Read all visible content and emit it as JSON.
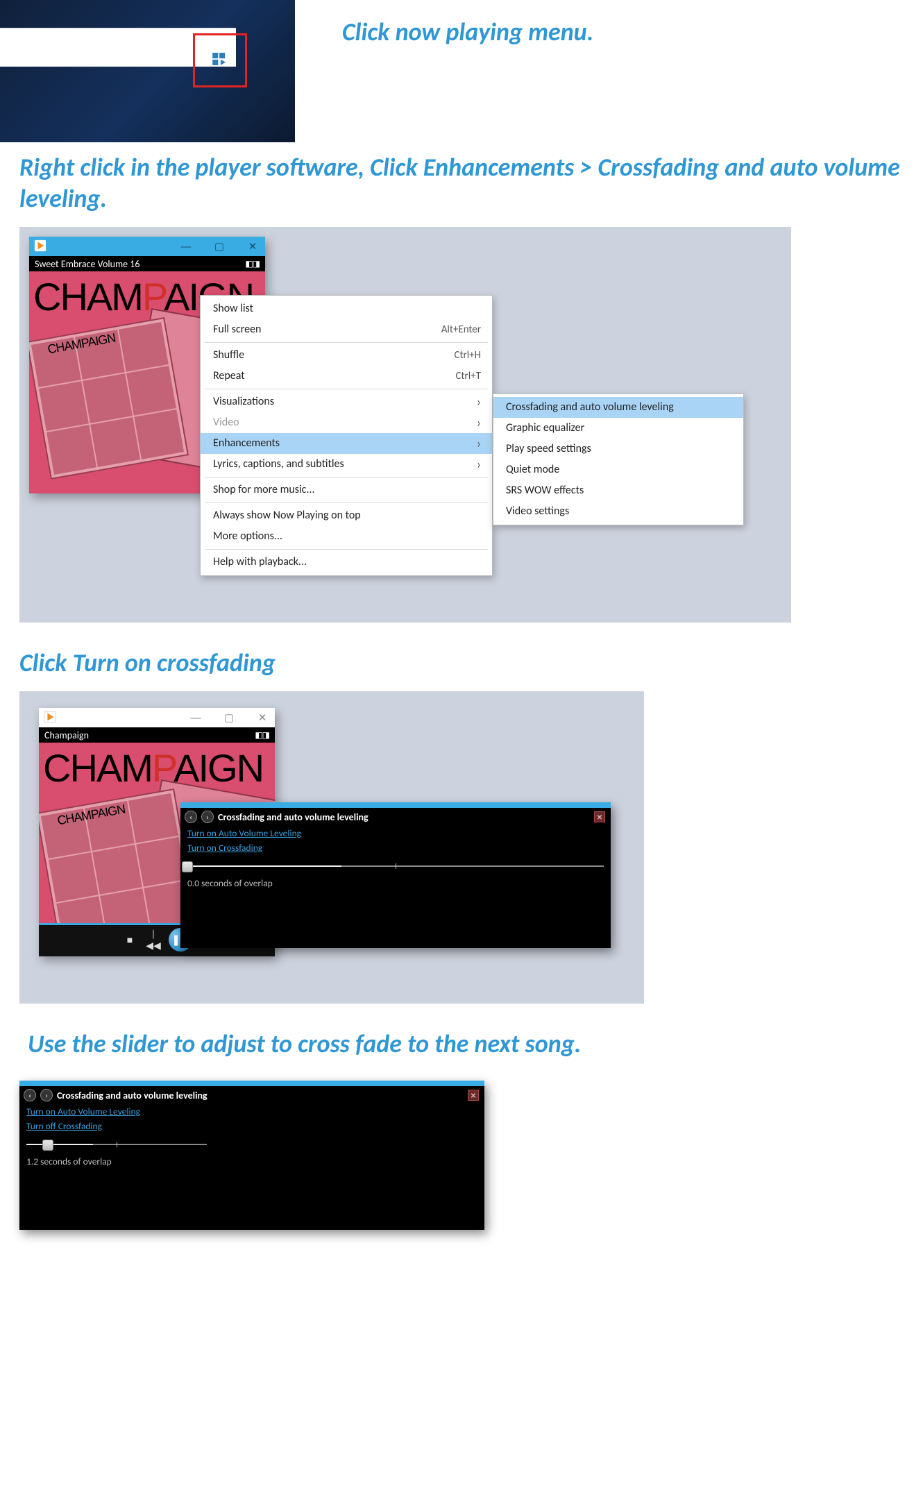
{
  "step1": {
    "instruction": "Click now playing menu."
  },
  "step2": {
    "instruction": "Right click in the player software, Click Enhancements > Crossfading and auto volume leveling.",
    "player": {
      "now_playing_title": "Sweet Embrace Volume 16",
      "album_art_text_pre": "CHAM",
      "album_art_text_mid": "P",
      "album_art_text_post": "AIGN",
      "mini_title": "CHAMPAIGN"
    },
    "context_menu": {
      "rows": [
        {
          "label": "Show list",
          "shortcut": "",
          "sub": false,
          "disabled": false
        },
        {
          "label": "Full screen",
          "shortcut": "Alt+Enter",
          "sub": false,
          "disabled": false
        },
        {
          "label": "Shuffle",
          "shortcut": "Ctrl+H",
          "sub": false,
          "disabled": false
        },
        {
          "label": "Repeat",
          "shortcut": "Ctrl+T",
          "sub": false,
          "disabled": false
        },
        {
          "label": "Visualizations",
          "shortcut": "",
          "sub": true,
          "disabled": false
        },
        {
          "label": "Video",
          "shortcut": "",
          "sub": true,
          "disabled": true
        },
        {
          "label": "Enhancements",
          "shortcut": "",
          "sub": true,
          "disabled": false,
          "hl": true
        },
        {
          "label": "Lyrics, captions, and subtitles",
          "shortcut": "",
          "sub": true,
          "disabled": false
        },
        {
          "label": "Shop for more music...",
          "shortcut": "",
          "sub": false,
          "disabled": false
        },
        {
          "label": "Always show Now Playing on top",
          "shortcut": "",
          "sub": false,
          "disabled": false
        },
        {
          "label": "More options...",
          "shortcut": "",
          "sub": false,
          "disabled": false
        },
        {
          "label": "Help with playback...",
          "shortcut": "",
          "sub": false,
          "disabled": false
        }
      ],
      "submenu": [
        "Crossfading and auto volume leveling",
        "Graphic equalizer",
        "Play speed settings",
        "Quiet mode",
        "SRS WOW effects",
        "Video settings"
      ]
    }
  },
  "step3": {
    "instruction": "Click Turn on crossfading",
    "player": {
      "now_playing_title": "Champaign"
    },
    "panel": {
      "title": "Crossfading and auto volume leveling",
      "link_auto": "Turn on Auto Volume Leveling",
      "link_cross": "Turn on Crossfading",
      "readout": "0.0 seconds of overlap",
      "slider_pos_pct": 0,
      "track_filled_pct": 37
    }
  },
  "step4": {
    "instruction": "Use the slider to adjust to cross fade to the next song.",
    "panel": {
      "title": "Crossfading and auto volume leveling",
      "link_auto": "Turn on Auto Volume Leveling",
      "link_cross": "Turn off Crossfading",
      "readout": "1.2 seconds of overlap",
      "slider_pos_pct": 12,
      "track_filled_pct": 37
    }
  }
}
